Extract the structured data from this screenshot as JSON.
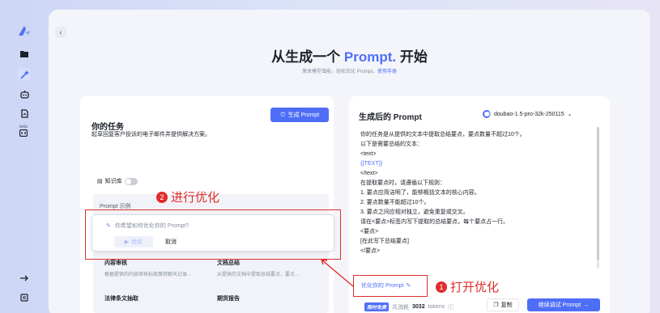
{
  "header": {
    "title_prefix": "从生成一个 ",
    "title_accent": "Prompt.",
    "title_suffix": " 开始",
    "subtitle": "激发模型潜能，轻松优化 Prompt。",
    "subtitle_link": "使用手册"
  },
  "task_panel": {
    "title": "你的任务",
    "generate_button": "生成 Prompt",
    "description": "起草回复客户投诉的电子邮件并提供解决方案。",
    "knowledge_base_label": "知识库",
    "examples_label": "Prompt 示例",
    "optimize_placeholder": "你希望如何优化你的 Prompt?",
    "optimize_button": "优化",
    "cancel_button": "取消",
    "examples": [
      {
        "title": "内容审核",
        "desc": "根据提供的内容审核标政策将聊天记录..."
      },
      {
        "title": "文档总结",
        "desc": "从提供的文档中提取总结要点，要点..."
      },
      {
        "title": "法律条文抽取",
        "desc": ""
      },
      {
        "title": "期货报告",
        "desc": ""
      }
    ]
  },
  "result_panel": {
    "title": "生成后的 Prompt",
    "model": "doubao-1.5-pro-32k-250115",
    "lines": [
      "你的任务是从提供的文本中提取总结要点，要点数量不超过10个。",
      "以下是需要总结的文本：",
      "<text>",
      "{{TEXT}}",
      "</text>",
      "在提取要点时，请遵循以下规则：",
      "1. 要点应简洁明了，能够概括文本的核心内容。",
      "2. 要点数量不能超过10个。",
      "3. 要点之间应相对独立，避免重复或交叉。",
      "请在<要点>标签内写下提取的总结要点，每个要点占一行。",
      "<要点>",
      "[在此写下总结要点]",
      "</要点>"
    ],
    "optimize_link": "优化你的 Prompt",
    "free_badge": "限时免费",
    "usage_prefix": "共消耗",
    "usage_value": "3032",
    "usage_suffix": "tokens",
    "copy_button": "复制",
    "continue_button": "继续调试 Prompt"
  },
  "annotations": {
    "step1_number": "1",
    "step1_text": "打开优化",
    "step2_number": "2",
    "step2_text": "进行优化",
    "color": "#e02c2c"
  },
  "sidebar": {
    "beta_label": "beta"
  },
  "colors": {
    "accent": "#4f6ef7",
    "background": "#f4f5fb"
  }
}
